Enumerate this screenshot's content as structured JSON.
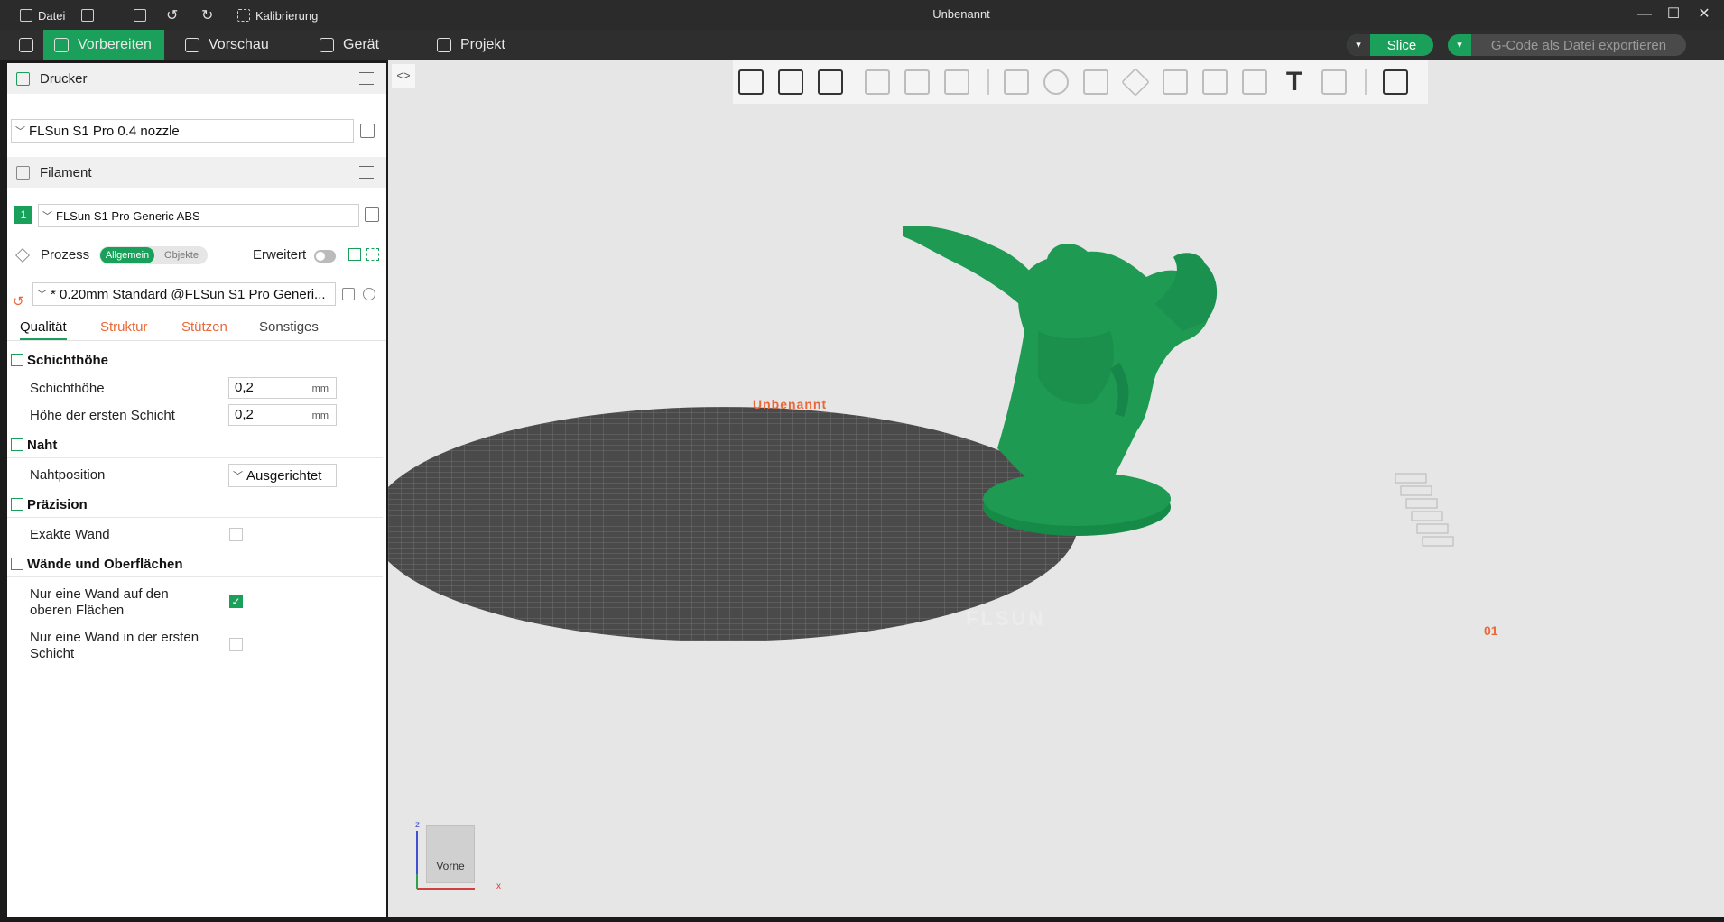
{
  "titlebar": {
    "file_menu": "Datei",
    "calibration": "Kalibrierung",
    "window_title": "Unbenannt"
  },
  "tabs": {
    "prepare": "Vorbereiten",
    "preview": "Vorschau",
    "device": "Gerät",
    "project": "Projekt"
  },
  "actions": {
    "slice": "Slice",
    "export": "G-Code als Datei exportieren"
  },
  "printer": {
    "section_title": "Drucker",
    "selected": "FLSun S1 Pro 0.4 nozzle"
  },
  "filament": {
    "section_title": "Filament",
    "slot": "1",
    "selected": "FLSun S1 Pro Generic ABS"
  },
  "process": {
    "section_title": "Prozess",
    "toggle_general": "Allgemein",
    "toggle_objects": "Objekte",
    "advanced_label": "Erweitert",
    "preset": "* 0.20mm Standard @FLSun S1 Pro Generi..."
  },
  "subtabs": {
    "quality": "Qualität",
    "structure": "Struktur",
    "supports": "Stützen",
    "other": "Sonstiges"
  },
  "settings": {
    "layer_height_group": "Schichthöhe",
    "layer_height_label": "Schichthöhe",
    "layer_height_value": "0,2",
    "first_layer_label": "Höhe der ersten Schicht",
    "first_layer_value": "0,2",
    "unit_mm": "mm",
    "seam_group": "Naht",
    "seam_position_label": "Nahtposition",
    "seam_position_value": "Ausgerichtet",
    "precision_group": "Präzision",
    "exact_wall_label": "Exakte Wand",
    "exact_wall_checked": false,
    "walls_group": "Wände und Oberflächen",
    "one_wall_top_label_1": "Nur eine Wand auf den",
    "one_wall_top_label_2": "oberen Flächen",
    "one_wall_top_checked": true,
    "one_wall_first_label_1": "Nur eine Wand in der ersten",
    "one_wall_first_label_2": "Schicht",
    "one_wall_first_checked": false
  },
  "viewport": {
    "plate_name": "Unbenannt",
    "plate_number": "01",
    "plate_brand": "FLSUN",
    "viewcube_face": "Vorne",
    "axis_x": "x",
    "axis_z": "z"
  },
  "colors": {
    "accent": "#1aa05a",
    "warning": "#e8683a",
    "model": "#1e9a52"
  }
}
